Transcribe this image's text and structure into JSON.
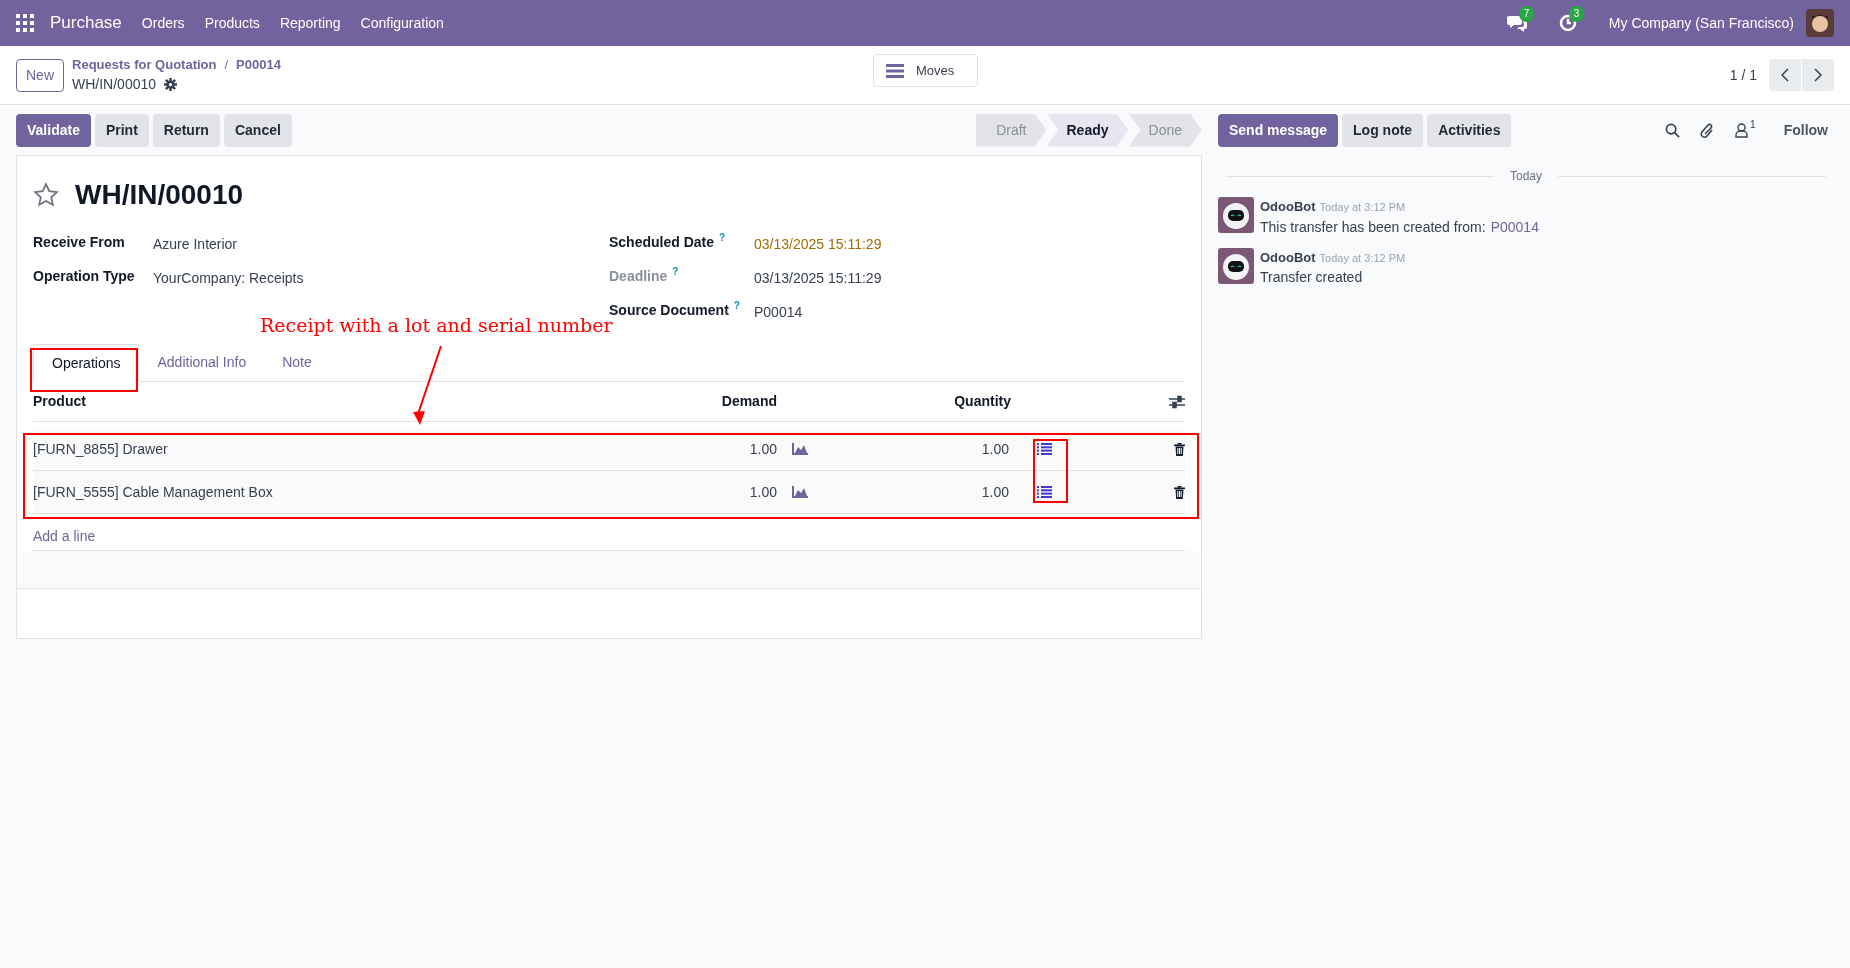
{
  "navbar": {
    "app": "Purchase",
    "menu": [
      "Orders",
      "Products",
      "Reporting",
      "Configuration"
    ],
    "messages_count": "7",
    "activities_count": "3",
    "company": "My Company (San Francisco)"
  },
  "control_panel": {
    "new_button": "New",
    "breadcrumbs": [
      "Requests for Quotation",
      "P00014"
    ],
    "breadcrumb_separator": "/",
    "record": "WH/IN/00010",
    "moves_button": "Moves",
    "pager": "1 / 1"
  },
  "actions": [
    "Validate",
    "Print",
    "Return",
    "Cancel"
  ],
  "stages": [
    {
      "label": "Draft",
      "selected": false
    },
    {
      "label": "Ready",
      "selected": true
    },
    {
      "label": "Done",
      "selected": false
    }
  ],
  "form": {
    "title": "WH/IN/00010",
    "starred": false,
    "left_fields": [
      {
        "label": "Receive From",
        "value": "Azure Interior",
        "emphasis": false,
        "muted": false
      },
      {
        "label": "Operation Type",
        "value": "YourCompany: Receipts",
        "emphasis": false,
        "muted": false
      }
    ],
    "right_fields": [
      {
        "label": "Scheduled Date",
        "help": "?",
        "value": "03/13/2025 15:11:29",
        "emphasis": true,
        "muted": false
      },
      {
        "label": "Deadline",
        "help": "?",
        "value": "03/13/2025 15:11:29",
        "emphasis": false,
        "muted": true
      },
      {
        "label": "Source Document",
        "help": "?",
        "value": "P00014",
        "emphasis": false,
        "muted": false
      }
    ],
    "tabs": [
      {
        "label": "Operations",
        "selected": true
      },
      {
        "label": "Additional Info",
        "selected": false
      },
      {
        "label": "Note",
        "selected": false
      }
    ],
    "table": {
      "columns": [
        "Product",
        "Demand",
        "Quantity"
      ],
      "rows": [
        {
          "product": "[FURN_8855] Drawer",
          "demand": "1.00",
          "quantity": "1.00"
        },
        {
          "product": "[FURN_5555] Cable Management Box",
          "demand": "1.00",
          "quantity": "1.00"
        }
      ],
      "add_line": "Add a line"
    }
  },
  "annotation": {
    "text": "Receipt with a lot and serial number"
  },
  "chatter": {
    "buttons": [
      {
        "label": "Send message",
        "selected": true
      },
      {
        "label": "Log note",
        "selected": false
      },
      {
        "label": "Activities",
        "selected": false
      }
    ],
    "followers_count": "1",
    "follow": "Follow",
    "separator": "Today",
    "messages": [
      {
        "author": "OdooBot",
        "time": "Today at 3:12 PM",
        "text": "This transfer has been created from:",
        "link": "P00014"
      },
      {
        "author": "OdooBot",
        "time": "Today at 3:12 PM",
        "text": "Transfer created"
      }
    ]
  }
}
